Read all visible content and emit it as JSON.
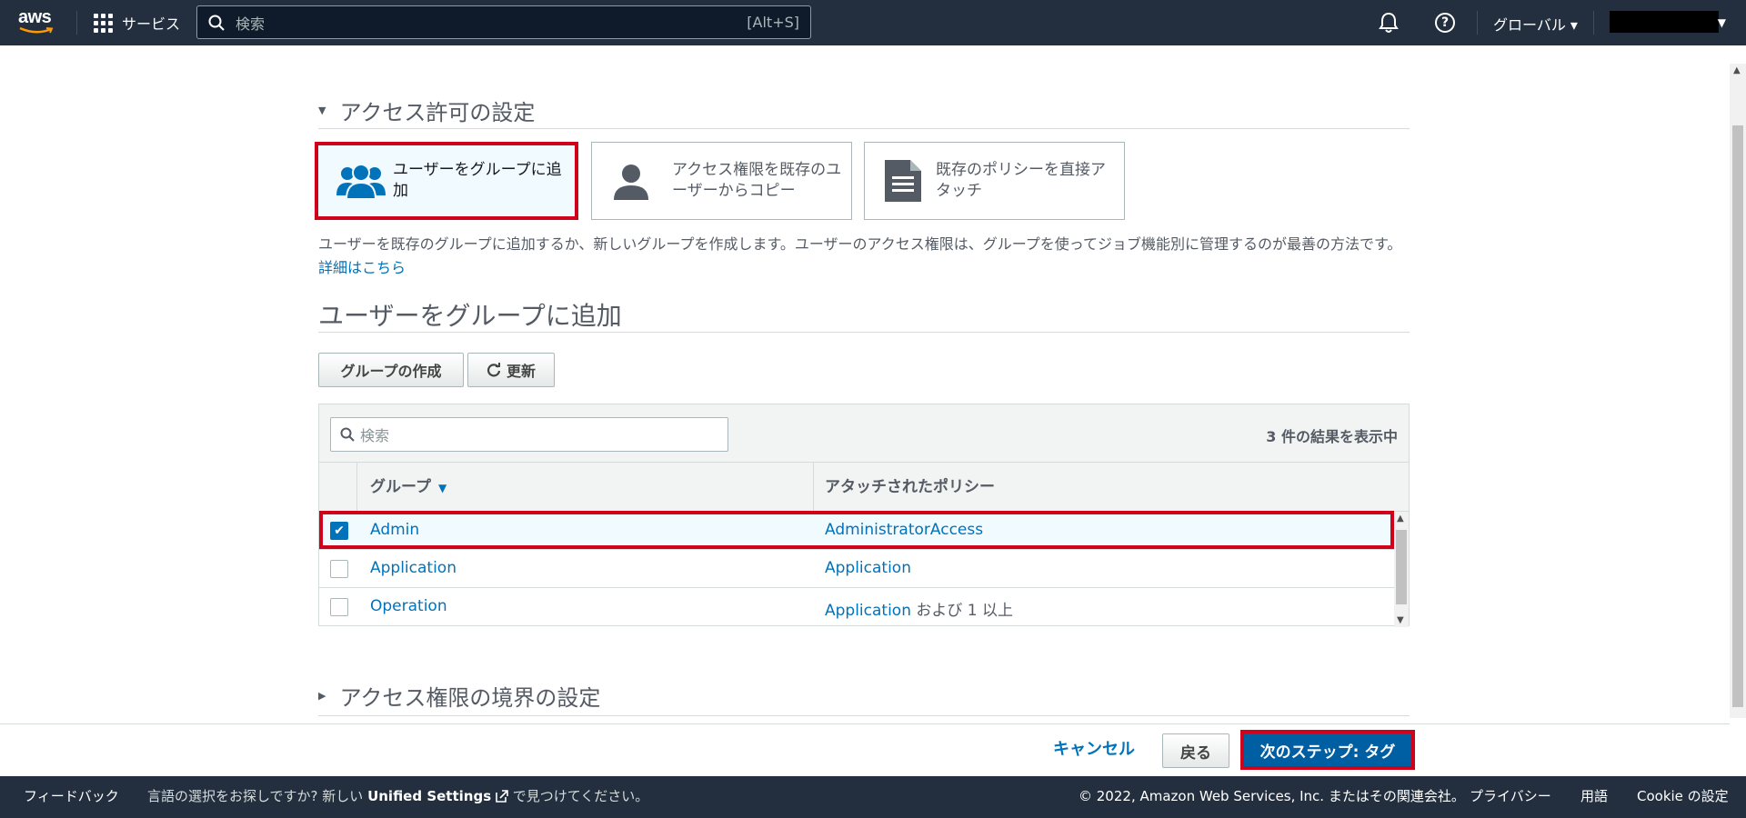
{
  "topnav": {
    "logo_text": "aws",
    "services_label": "サービス",
    "search_placeholder": "検索",
    "search_shortcut": "[Alt+S]",
    "region_label": "グローバル ▾"
  },
  "permissions": {
    "section_title": "アクセス許可の設定",
    "tiles": [
      {
        "label_line1": "ユーザーをグループに追",
        "label_line2": "加"
      },
      {
        "label_line1": "アクセス権限を既存のユ",
        "label_line2": "ーザーからコピー"
      },
      {
        "label_line1": "既存のポリシーを直接ア",
        "label_line2": "タッチ"
      }
    ],
    "description": "ユーザーを既存のグループに追加するか、新しいグループを作成します。ユーザーのアクセス権限は、グループを使ってジョブ機能別に管理するのが最善の方法です。",
    "details_link": "詳細はこちら"
  },
  "group_section": {
    "title": "ユーザーをグループに追加",
    "create_button": "グループの作成",
    "refresh_button": "更新",
    "search_placeholder": "検索",
    "results_count": "3 件の結果を表示中",
    "columns": {
      "group": "グループ",
      "policies": "アタッチされたポリシー"
    },
    "rows": [
      {
        "group": "Admin",
        "policy": "AdministratorAccess",
        "policy_extra": "",
        "checked": true
      },
      {
        "group": "Application",
        "policy": "Application",
        "policy_extra": "",
        "checked": false
      },
      {
        "group": "Operation",
        "policy": "Application",
        "policy_extra": " および 1 以上",
        "checked": false
      }
    ]
  },
  "boundary": {
    "section_title": "アクセス権限の境界の設定"
  },
  "actions": {
    "cancel": "キャンセル",
    "back": "戻る",
    "next": "次のステップ: タグ"
  },
  "footer": {
    "feedback": "フィードバック",
    "lang_prefix": "言語の選択をお探しですか? 新しい",
    "lang_link": "Unified Settings",
    "lang_suffix": "で見つけてください。",
    "copyright": "© 2022, Amazon Web Services, Inc. またはその関連会社。",
    "privacy": "プライバシー",
    "terms": "用語",
    "cookie": "Cookie の設定"
  },
  "colors": {
    "nav_bg": "#232f3e",
    "link": "#0073bb",
    "primary_button": "#005ea2",
    "highlight": "#d0021b"
  }
}
